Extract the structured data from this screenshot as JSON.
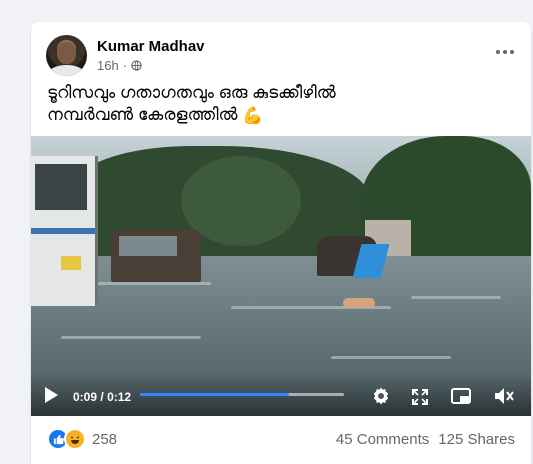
{
  "post": {
    "author": "Kumar Madhav",
    "time": "16h",
    "dot": "·",
    "caption_line1": "ടൂറിസവും ഗതാഗതവും ഒരു കുടക്കീഴിൽ",
    "caption_line2": "നമ്പർവൺ കേരളത്തിൽ",
    "caption_emoji": "💪"
  },
  "video": {
    "current_time": "0:09",
    "duration": "0:12",
    "time_separator": "/",
    "progress": 0.73
  },
  "footer": {
    "reaction_count": "258",
    "comments": "45 Comments",
    "shares": "125 Shares",
    "reactions": [
      "like-icon",
      "haha-icon"
    ]
  },
  "colors": {
    "accent": "#2d88ff",
    "like": "#1877f2",
    "haha": "#f7b125"
  }
}
